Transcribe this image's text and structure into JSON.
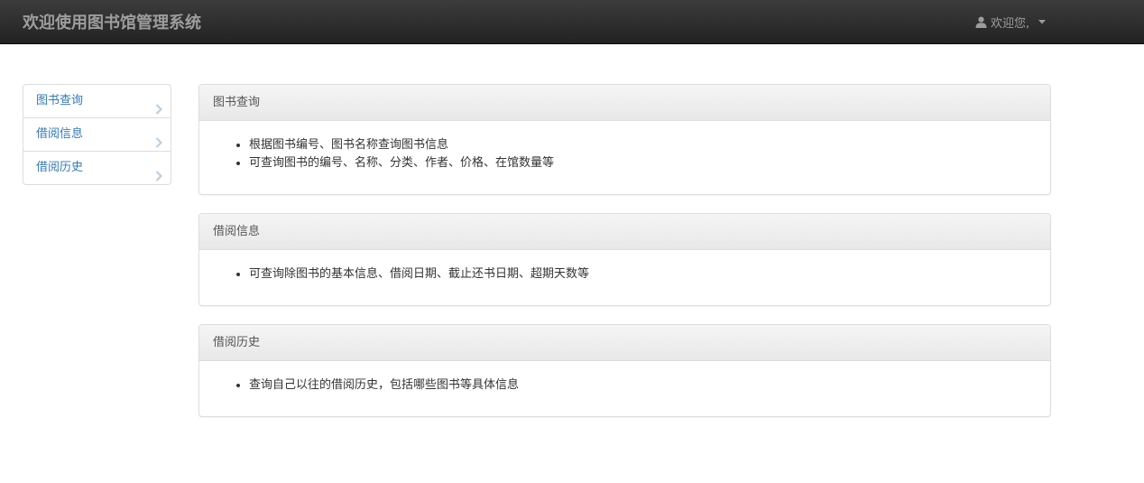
{
  "navbar": {
    "brand": "欢迎使用图书馆管理系统",
    "user_greeting": "欢迎您,",
    "user_icon": "user-icon",
    "caret_icon": "caret-down-icon"
  },
  "sidebar": {
    "items": [
      {
        "label": "图书查询",
        "icon": "chevron-right-icon"
      },
      {
        "label": "借阅信息",
        "icon": "chevron-right-icon"
      },
      {
        "label": "借阅历史",
        "icon": "chevron-right-icon"
      }
    ]
  },
  "panels": [
    {
      "title": "图书查询",
      "items": [
        "根据图书编号、图书名称查询图书信息",
        "可查询图书的编号、名称、分类、作者、价格、在馆数量等"
      ]
    },
    {
      "title": "借阅信息",
      "items": [
        "可查询除图书的基本信息、借阅日期、截止还书日期、超期天数等"
      ]
    },
    {
      "title": "借阅历史",
      "items": [
        "查询自己以往的借阅历史，包括哪些图书等具体信息"
      ]
    }
  ],
  "colors": {
    "navbar_bg": "#222222",
    "navbar_text": "#9d9d9d",
    "link": "#337ab7",
    "chevron": "#b9cfe4",
    "border": "#dddddd"
  }
}
